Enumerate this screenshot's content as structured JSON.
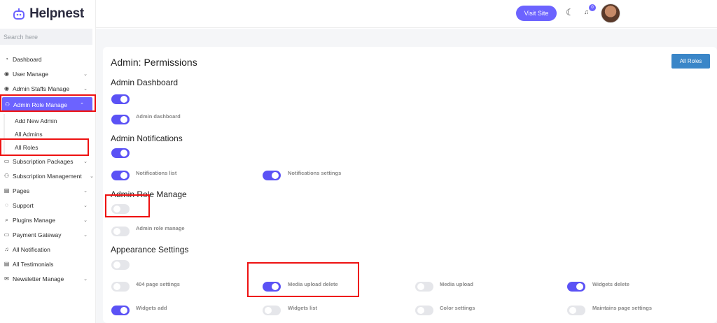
{
  "brand": {
    "name": "Helpnest"
  },
  "search": {
    "placeholder": "Search here"
  },
  "sidebar": {
    "items": [
      {
        "label": "Dashboard",
        "icon": "dashboard-icon"
      },
      {
        "label": "User Manage",
        "icon": "user-icon"
      },
      {
        "label": "Admin Staffs Manage",
        "icon": "staff-icon"
      },
      {
        "label": "Admin Role Manage",
        "icon": "role-icon"
      },
      {
        "label": "Subscription Packages",
        "icon": "package-icon"
      },
      {
        "label": "Subscription Management",
        "icon": "subscription-icon"
      },
      {
        "label": "Pages",
        "icon": "pages-icon"
      },
      {
        "label": "Support",
        "icon": "support-icon"
      },
      {
        "label": "Plugins Manage",
        "icon": "plugin-icon"
      },
      {
        "label": "Payment Gateway",
        "icon": "payment-icon"
      },
      {
        "label": "All Notification",
        "icon": "bell-icon"
      },
      {
        "label": "All Testimonials",
        "icon": "testimonial-icon"
      },
      {
        "label": "Newsletter Manage",
        "icon": "newsletter-icon"
      }
    ],
    "sub_items": [
      {
        "label": "Add New Admin"
      },
      {
        "label": "All Admins"
      },
      {
        "label": "All Roles"
      }
    ]
  },
  "header": {
    "visit_site": "Visit Site",
    "notification_count": "0"
  },
  "main": {
    "title": "Admin: Permissions",
    "all_roles": "All Roles",
    "sections": {
      "admin_dashboard": "Admin Dashboard",
      "admin_notifications": "Admin Notifications",
      "admin_role_manage": "Admin Role Manage",
      "appearance_settings": "Appearance Settings"
    },
    "permissions": {
      "admin_dashboard": {
        "label": "Admin dashboard",
        "on": true
      },
      "notifications_list": {
        "label": "Notifications list",
        "on": true
      },
      "notifications_settings": {
        "label": "Notifications settings",
        "on": true
      },
      "admin_role_manage": {
        "label": "Admin role manage",
        "on": false
      },
      "page_404": {
        "label": "404 page settings",
        "on": false
      },
      "media_upload_delete": {
        "label": "Media upload delete",
        "on": true
      },
      "media_upload": {
        "label": "Media upload",
        "on": false
      },
      "widgets_delete": {
        "label": "Widgets delete",
        "on": true
      },
      "widgets_add": {
        "label": "Widgets add",
        "on": true
      },
      "widgets_list": {
        "label": "Widgets list",
        "on": false
      },
      "color_settings": {
        "label": "Color settings",
        "on": false
      },
      "maintains_page": {
        "label": "Maintains page settings",
        "on": false
      }
    },
    "section_toggles": {
      "admin_dashboard": true,
      "admin_notifications": true,
      "admin_role_manage": false,
      "appearance_settings": false
    }
  },
  "colors": {
    "accent": "#6c63ff",
    "toggle_on": "#5b52f5",
    "button_blue": "#3a86c8",
    "highlight_box": "#e11"
  }
}
